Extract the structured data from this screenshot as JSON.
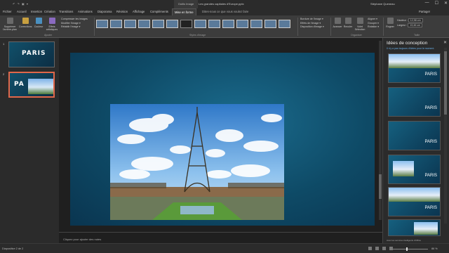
{
  "titlebar": {
    "document_title": "Les grandes capitales d'Europe.pptx",
    "context_tab": "Outils Image",
    "user": "Stéphane Queneau",
    "quick_access": "↶ ↷ ▣ ▾",
    "win_min": "—",
    "win_max": "☐",
    "win_close": "✕"
  },
  "tabs": [
    {
      "label": "Fichier"
    },
    {
      "label": "Accueil"
    },
    {
      "label": "Insertion"
    },
    {
      "label": "Création"
    },
    {
      "label": "Transitions"
    },
    {
      "label": "Animations"
    },
    {
      "label": "Diaporama"
    },
    {
      "label": "Révision"
    },
    {
      "label": "Affichage"
    },
    {
      "label": "Compléments"
    },
    {
      "label": "Mise en forme"
    }
  ],
  "tellme": "Dites-nous ce que vous voulez faire",
  "share": "Partager",
  "ribbon": {
    "remove_bg": "Supprimer l'arrière-plan",
    "corrections": "Corrections",
    "color": "Couleur",
    "effects": "Effets artistiques",
    "adjust_list": [
      "Compresser les images",
      "Modifier l'image ▾",
      "Rétablir l'image ▾"
    ],
    "adjust_group": "Ajuster",
    "styles_group": "Styles d'image",
    "picture_list": [
      "Bordure de l'image ▾",
      "Effets de l'image ▾",
      "Disposition d'image ▾"
    ],
    "forward": "Avancer",
    "backward": "Reculer",
    "selection": "Volet Sélection",
    "arrange_list": [
      "Aligner ▾",
      "Grouper ▾",
      "Rotation ▾"
    ],
    "arrange_group": "Organiser",
    "crop": "Rogner",
    "height_label": "Hauteur :",
    "height_value": "12,98 cm",
    "width_label": "Largeur :",
    "width_value": "19,46 cm",
    "size_group": "Taille"
  },
  "slides": [
    {
      "number": "1",
      "title": "PARIS"
    },
    {
      "number": "2",
      "title": "PA"
    }
  ],
  "design_pane": {
    "title": "Idées de conception",
    "subtitle": "Il n'y a pas toujours d'idées pour le moment.",
    "close": "✕",
    "thumb_label": "PARIS",
    "footer": "Avec les services intelligents d'Office"
  },
  "notes_placeholder": "Cliquez pour ajouter des notes",
  "status": {
    "left": "Diapositive 2 de 2",
    "zoom": "86 %"
  }
}
